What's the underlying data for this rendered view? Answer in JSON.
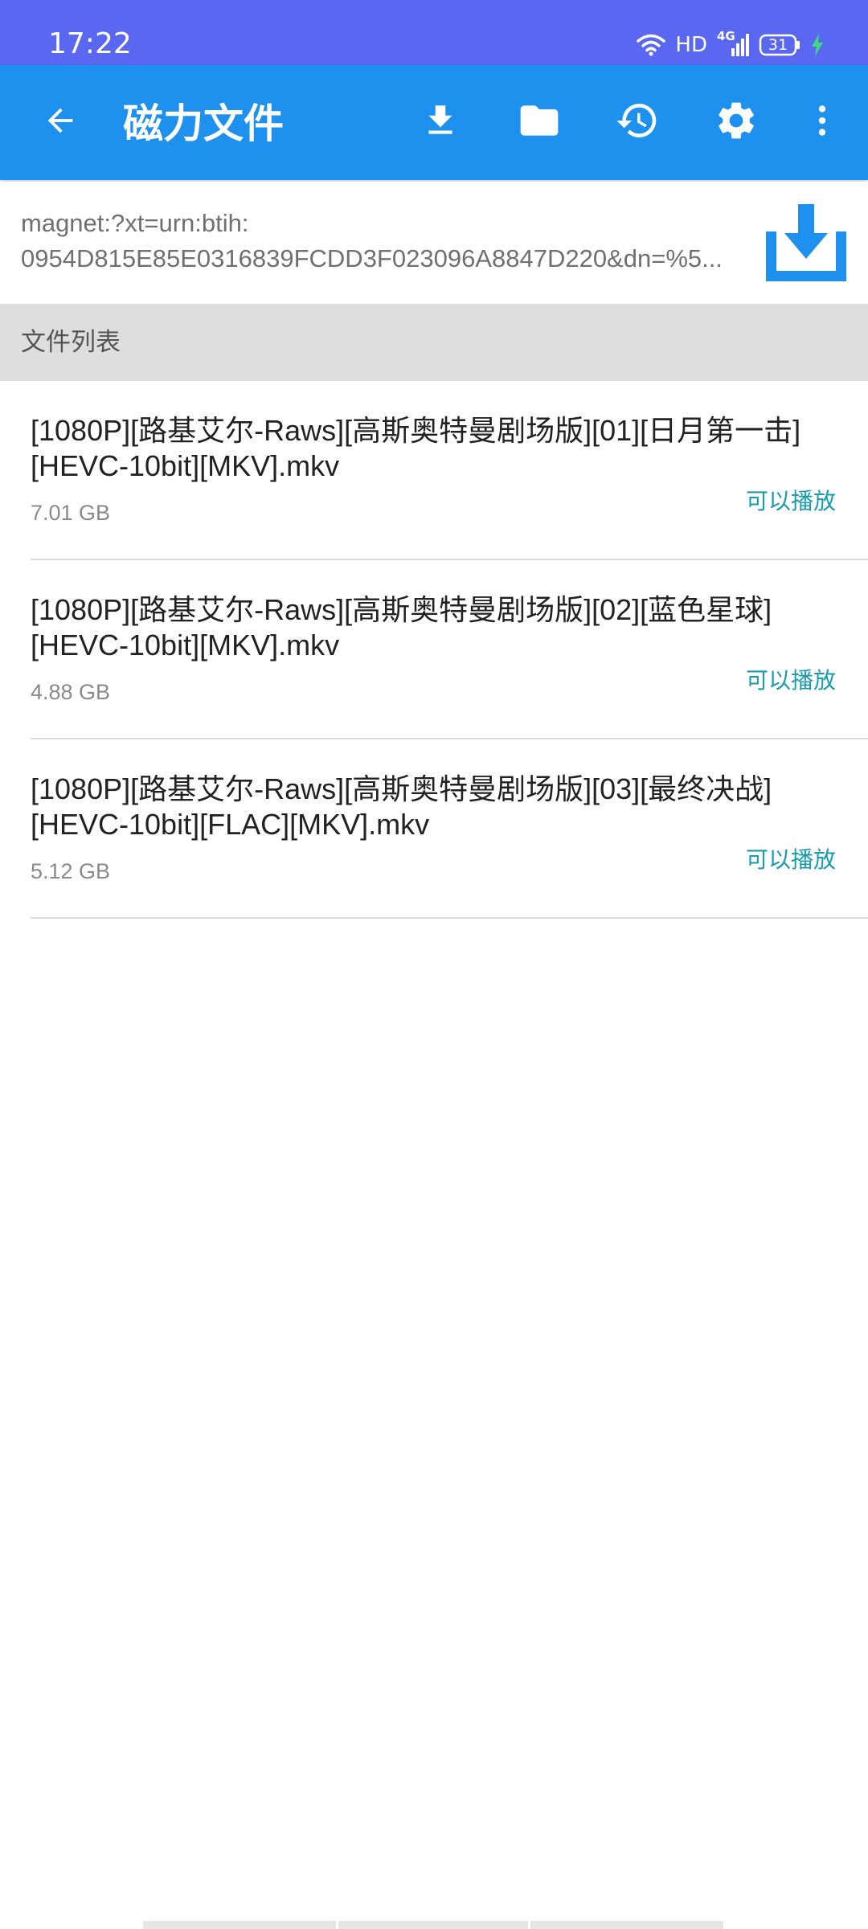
{
  "status_bar": {
    "time": "17:22",
    "network_label": "HD",
    "signal_label": "4G",
    "battery_level": "31",
    "icons": [
      "wifi-icon",
      "signal-icon",
      "battery-icon",
      "charging-icon"
    ]
  },
  "app_bar": {
    "title": "磁力文件",
    "background": "#1e90ee",
    "icons": [
      "back-arrow-icon",
      "download-icon",
      "folder-icon",
      "history-icon",
      "settings-icon",
      "more-vert-icon"
    ]
  },
  "magnet": {
    "line1": "magnet:?xt=urn:btih:",
    "line2": "0954D815E85E0316839FCDD3F023096A8847D220&dn=%5...",
    "icon": "magnet-download-icon"
  },
  "file_list": {
    "header": "文件列表",
    "items": [
      {
        "name_line1": "[1080P][路基艾尔-Raws][高斯奥特曼剧场版][01][日月第一击]",
        "name_line2": "[HEVC-10bit][MKV].mkv",
        "size": "7.01 GB",
        "action": "可以播放"
      },
      {
        "name_line1": "[1080P][路基艾尔-Raws][高斯奥特曼剧场版][02][蓝色星球]",
        "name_line2": "[HEVC-10bit][MKV].mkv",
        "size": "4.88 GB",
        "action": "可以播放"
      },
      {
        "name_line1": "[1080P][路基艾尔-Raws][高斯奥特曼剧场版][03][最终决战]",
        "name_line2": "[HEVC-10bit][FLAC][MKV].mkv",
        "size": "5.12 GB",
        "action": "可以播放"
      }
    ]
  },
  "colors": {
    "status_bar": "#5a67f0",
    "accent": "#1e90ee",
    "play_text": "#1a9bb0"
  }
}
